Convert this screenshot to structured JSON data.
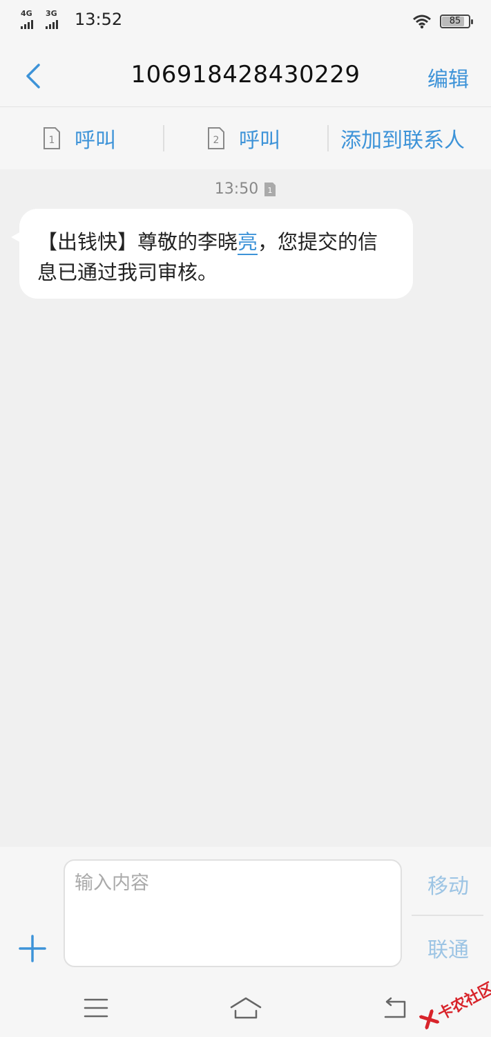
{
  "status": {
    "net1": "4G",
    "net2": "3G",
    "time": "13:52",
    "battery": "85",
    "battery_level": 0.85
  },
  "header": {
    "title": "106918428430229",
    "edit": "编辑"
  },
  "actions": {
    "call1": "呼叫",
    "call2": "呼叫",
    "add_contact": "添加到联系人",
    "sim1_label": "1",
    "sim2_label": "2"
  },
  "chat": {
    "timestamp": "13:50",
    "sim_badge": "1",
    "message_pre": "【出钱快】尊敬的李晓",
    "message_highlight": "亮",
    "message_post": "，您提交的信息已通过我司审核。"
  },
  "composer": {
    "placeholder": "输入内容",
    "send_sim1": "移动",
    "send_sim2": "联通"
  },
  "watermark": "卡农社区",
  "icons": [
    "back-icon",
    "sim-card-icon",
    "plus-icon",
    "menu-icon",
    "home-icon",
    "back-nav-icon",
    "wifi-icon",
    "battery-icon"
  ],
  "colors": {
    "accent": "#3d93d8",
    "background": "#f0f0f0",
    "bar": "#f6f6f6",
    "bubble": "#ffffff"
  }
}
